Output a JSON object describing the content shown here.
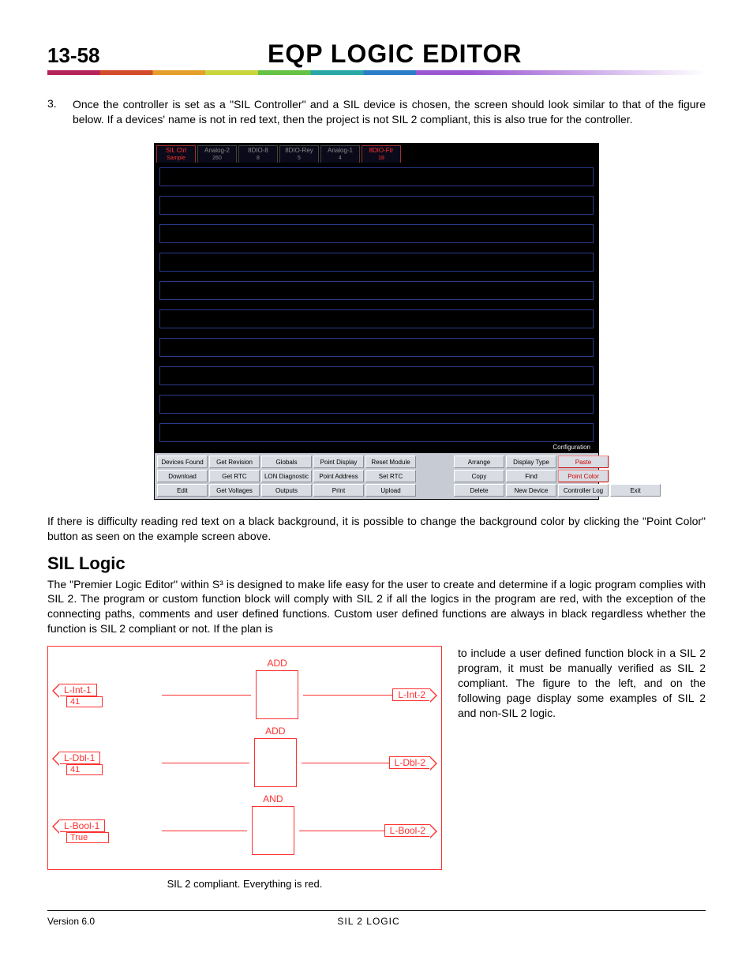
{
  "header": {
    "page_number": "13-58",
    "title": "EQP LOGIC EDITOR"
  },
  "intro": {
    "num": "3.",
    "text": "Once the controller is set as a \"SIL Controller\" and a SIL device is chosen, the screen should look similar to that of the figure below.  If a devices' name is not in red text, then the project is not SIL 2 compliant, this is also true for the controller."
  },
  "screenshot": {
    "tabs": [
      {
        "l1": "SIL Ctrl",
        "l2": "Sample",
        "red": true
      },
      {
        "l1": "Analog-2",
        "l2": "260",
        "red": false
      },
      {
        "l1": "8DIO-8",
        "l2": "8",
        "red": false
      },
      {
        "l1": "8DIO-Rey",
        "l2": "5",
        "red": false
      },
      {
        "l1": "Analog-1",
        "l2": "4",
        "red": false
      },
      {
        "l1": "8DIO-Ftr",
        "l2": "18",
        "red": true
      }
    ],
    "config_label": "Configuration",
    "buttons": {
      "row1": [
        {
          "t": "Devices Found",
          "r": false
        },
        {
          "t": "Get Revision",
          "r": false
        },
        {
          "t": "Globals",
          "r": false
        },
        {
          "t": "Point Display",
          "r": false
        },
        {
          "t": "Reset Module",
          "r": false
        }
      ],
      "row1b": [
        {
          "t": "Arrange",
          "r": false
        },
        {
          "t": "Display Type",
          "r": false
        },
        {
          "t": "Paste",
          "r": true
        }
      ],
      "row2": [
        {
          "t": "Download",
          "r": false
        },
        {
          "t": "Get RTC",
          "r": false
        },
        {
          "t": "LON Diagnostic",
          "r": false
        },
        {
          "t": "Point Address",
          "r": false
        },
        {
          "t": "Set RTC",
          "r": false
        }
      ],
      "row2b": [
        {
          "t": "Copy",
          "r": false
        },
        {
          "t": "Find",
          "r": false
        },
        {
          "t": "Point Color",
          "r": true
        }
      ],
      "row3": [
        {
          "t": "Edit",
          "r": false
        },
        {
          "t": "Get Voltages",
          "r": false
        },
        {
          "t": "Outputs",
          "r": false
        },
        {
          "t": "Print",
          "r": false
        },
        {
          "t": "Upload",
          "r": false
        }
      ],
      "row3b": [
        {
          "t": "Delete",
          "r": false
        },
        {
          "t": "New Device",
          "r": false
        },
        {
          "t": "Controller Log",
          "r": false
        },
        {
          "t": "Exit",
          "r": false
        }
      ]
    }
  },
  "after_screenshot": "If there is difficulty reading red text on a black background, it is possible to change the background color by clicking the \"Point Color\" button as seen on the example screen above.",
  "section": {
    "heading": "SIL Logic",
    "para": "The \"Premier Logic Editor\" within S³ is designed to make life easy for the user to create and determine if a logic program complies with SIL 2.  The program or custom function block will comply with SIL 2 if all the logics in the program are red, with the exception of the connecting paths, comments and user defined functions.  Custom user defined functions are always in black regardless whether the function is SIL 2 compliant or not.  If the plan is",
    "aside": "to include a user defined function block in a SIL 2 program, it must be manually verified as SIL 2 compliant.  The figure to the left, and on the following page display some examples of SIL 2 and non-SIL 2 logic."
  },
  "logic": {
    "blocks": [
      "ADD",
      "ADD",
      "AND"
    ],
    "rows": [
      {
        "in": "L-Int-1",
        "val": "41",
        "out": "L-Int-2"
      },
      {
        "in": "L-Dbl-1",
        "val": "41",
        "out": "L-Dbl-2"
      },
      {
        "in": "L-Bool-1",
        "val": "True",
        "out": "L-Bool-2"
      }
    ],
    "caption": "SIL 2 compliant.  Everything is red."
  },
  "footer": {
    "left": "Version 6.0",
    "center": "SIL 2 LOGIC"
  }
}
